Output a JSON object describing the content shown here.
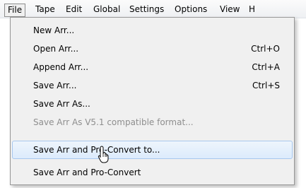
{
  "menubar": {
    "items": [
      "File",
      "Tape",
      "Edit",
      "Global",
      "Settings",
      "Options",
      "View",
      "H"
    ]
  },
  "file_menu": {
    "items": [
      {
        "label": "New Arr...",
        "shortcut": ""
      },
      {
        "label": "Open Arr...",
        "shortcut": "Ctrl+O"
      },
      {
        "label": "Append Arr...",
        "shortcut": "Ctrl+A"
      },
      {
        "label": "Save Arr...",
        "shortcut": "Ctrl+S"
      },
      {
        "label": "Save Arr As...",
        "shortcut": ""
      },
      {
        "label": "Save Arr As V5.1 compatible format...",
        "shortcut": ""
      },
      {
        "label": "Save Arr and Pro-Convert to...",
        "shortcut": ""
      },
      {
        "label": "Save Arr and Pro-Convert",
        "shortcut": ""
      }
    ]
  },
  "icons": {
    "cursor": "mouse-pointer-icon"
  },
  "colors": {
    "hover_border": "#a8c8ef",
    "disabled_text": "#8e8e8e"
  }
}
